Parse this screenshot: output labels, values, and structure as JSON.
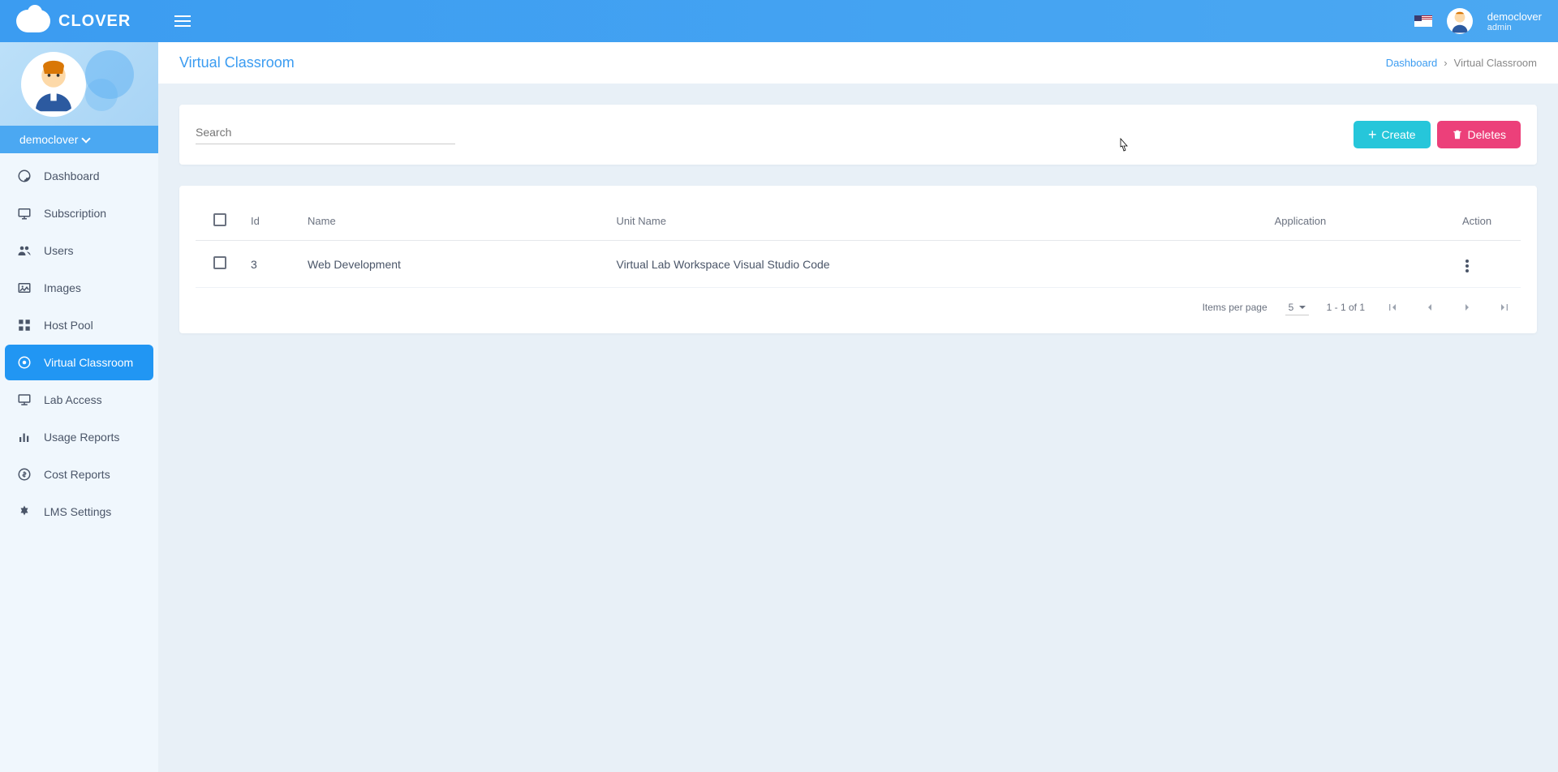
{
  "brand": "CLOVER",
  "user": {
    "name": "democlover",
    "role": "admin"
  },
  "sidebar": {
    "username": "democlover",
    "items": [
      {
        "label": "Dashboard"
      },
      {
        "label": "Subscription"
      },
      {
        "label": "Users"
      },
      {
        "label": "Images"
      },
      {
        "label": "Host Pool"
      },
      {
        "label": "Virtual Classroom"
      },
      {
        "label": "Lab Access"
      },
      {
        "label": "Usage Reports"
      },
      {
        "label": "Cost Reports"
      },
      {
        "label": "LMS Settings"
      }
    ]
  },
  "page": {
    "title": "Virtual Classroom",
    "breadcrumb": {
      "root": "Dashboard",
      "current": "Virtual Classroom"
    }
  },
  "toolbar": {
    "search_placeholder": "Search",
    "create_label": "Create",
    "deletes_label": "Deletes"
  },
  "table": {
    "headers": {
      "id": "Id",
      "name": "Name",
      "unit_name": "Unit Name",
      "application": "Application",
      "action": "Action"
    },
    "rows": [
      {
        "id": "3",
        "name": "Web Development",
        "unit_name": "Virtual Lab Workspace Visual Studio Code",
        "application": ""
      }
    ]
  },
  "pagination": {
    "items_per_page_label": "Items per page",
    "per_page": "5",
    "range": "1 - 1 of 1"
  }
}
